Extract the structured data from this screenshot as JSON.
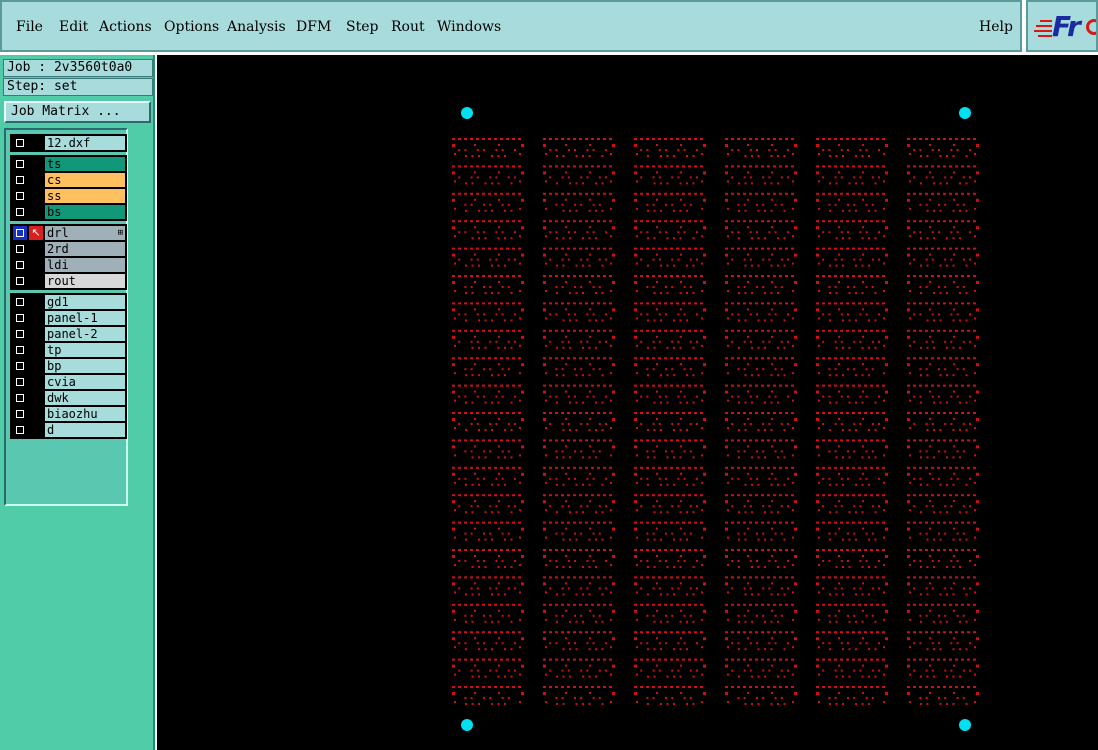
{
  "menu": {
    "file": "File",
    "edit": "Edit",
    "actions": "Actions",
    "options": "Options",
    "analysis": "Analysis",
    "dfm": "DFM",
    "step": "Step",
    "rout": "Rout",
    "windows": "Windows",
    "help": "Help"
  },
  "logo": {
    "text": "Fr"
  },
  "info": {
    "job": "Job : 2v3560t0a0",
    "step": "Step: set",
    "job_matrix": "Job Matrix ..."
  },
  "layers": {
    "misc": [
      {
        "name": "12.dxf",
        "color": "#a8dcdc"
      }
    ],
    "board": [
      {
        "name": "ts",
        "color": "#109878"
      },
      {
        "name": "cs",
        "color": "#ffc060"
      },
      {
        "name": "ss",
        "color": "#ffc060"
      },
      {
        "name": "bs",
        "color": "#109878"
      }
    ],
    "drill": [
      {
        "name": "drl",
        "color": "#a0b0b8"
      },
      {
        "name": "2rd",
        "color": "#a0b0b8"
      },
      {
        "name": "ldi",
        "color": "#a0b0b8"
      },
      {
        "name": "rout",
        "color": "#d8d8d8"
      }
    ],
    "other": [
      {
        "name": "gd1",
        "color": "#a8dcdc"
      },
      {
        "name": "panel-1",
        "color": "#a8dcdc"
      },
      {
        "name": "panel-2",
        "color": "#a8dcdc"
      },
      {
        "name": "tp",
        "color": "#a8dcdc"
      },
      {
        "name": "bp",
        "color": "#a8dcdc"
      },
      {
        "name": "cvia",
        "color": "#a8dcdc"
      },
      {
        "name": "dwk",
        "color": "#a8dcdc"
      },
      {
        "name": "biaozhu",
        "color": "#a8dcdc"
      },
      {
        "name": "d",
        "color": "#a8dcdc"
      }
    ]
  },
  "canvas": {
    "background": "#000000",
    "pattern_color": "#d01010",
    "fiducial_color": "#00e0f0",
    "columns": 6,
    "rows": 21
  }
}
